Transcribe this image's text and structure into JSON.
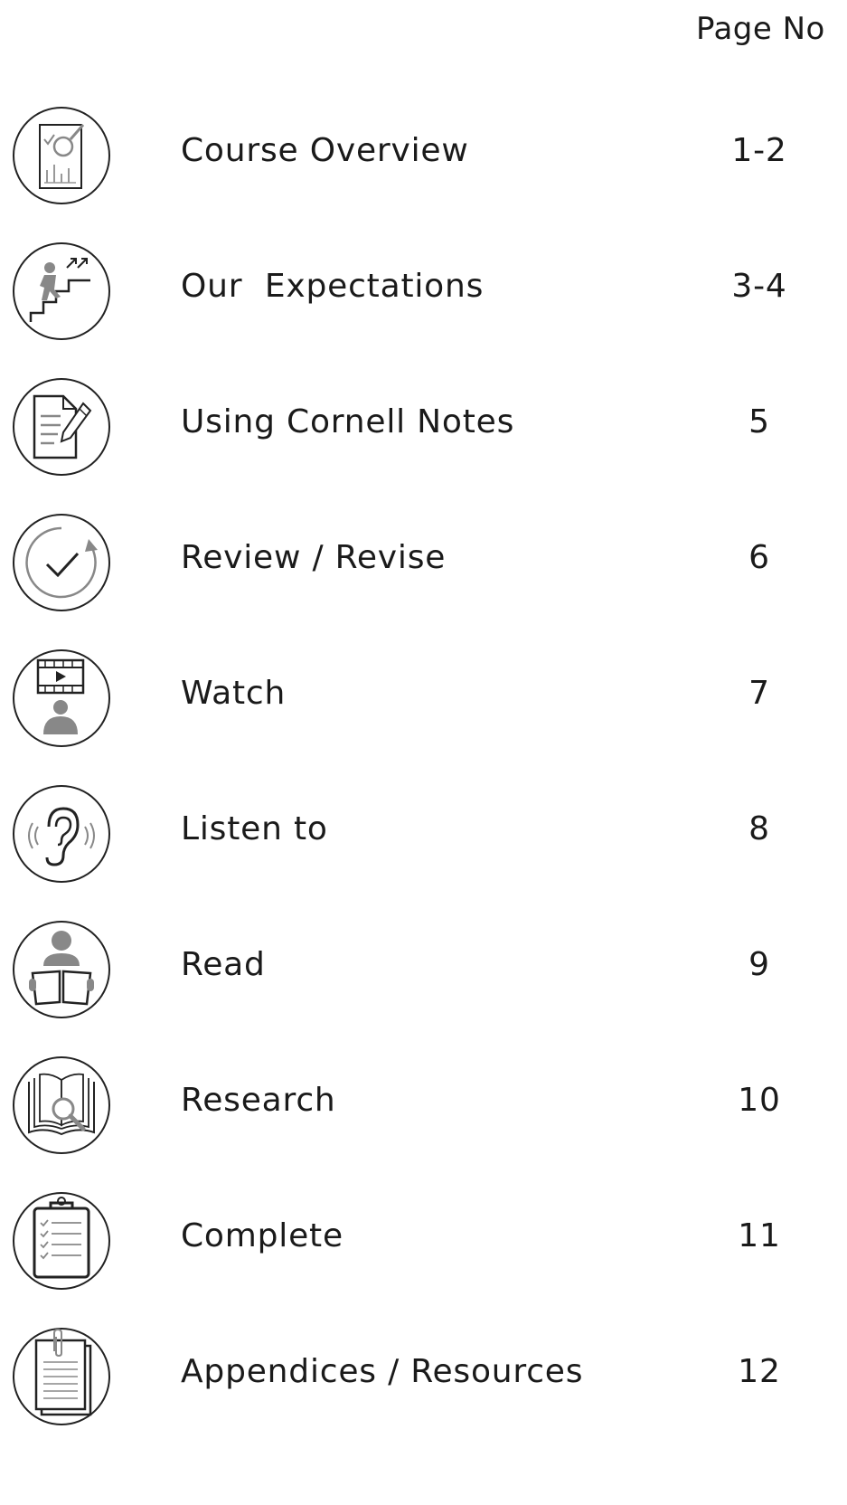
{
  "header": {
    "label": "Page No"
  },
  "items": [
    {
      "title": "Course Overview",
      "page": "1-2",
      "icon": "report-magnifier-icon"
    },
    {
      "title": "Our  Expectations",
      "page": "3-4",
      "icon": "climbing-stairs-icon"
    },
    {
      "title": "Using Cornell Notes",
      "page": "5",
      "icon": "document-pencil-icon"
    },
    {
      "title": "Review / Revise",
      "page": "6",
      "icon": "check-refresh-icon"
    },
    {
      "title": "Watch",
      "page": "7",
      "icon": "video-viewer-icon"
    },
    {
      "title": "Listen to",
      "page": "8",
      "icon": "ear-icon"
    },
    {
      "title": "Read",
      "page": "9",
      "icon": "reader-book-icon"
    },
    {
      "title": "Research",
      "page": "10",
      "icon": "book-magnifier-icon"
    },
    {
      "title": "Complete",
      "page": "11",
      "icon": "clipboard-checklist-icon"
    },
    {
      "title": "Appendices / Resources",
      "page": "12",
      "icon": "paperclip-documents-icon"
    }
  ]
}
